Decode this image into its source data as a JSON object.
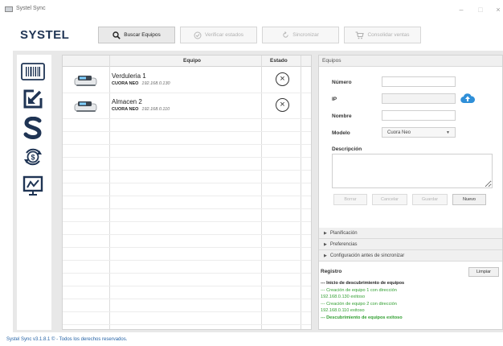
{
  "window": {
    "title": "Systel Sync",
    "controls": {
      "minimize": "–",
      "maximize": "□",
      "close": "×"
    }
  },
  "header": {
    "logo": "SYSTEL",
    "toolbar": [
      {
        "label": "Buscar Equipos",
        "icon": "search-icon",
        "active": true
      },
      {
        "label": "Verificar estados",
        "icon": "check-circle-icon",
        "active": false
      },
      {
        "label": "Sincronizar",
        "icon": "sync-icon",
        "active": false
      },
      {
        "label": "Consolidar ventas",
        "icon": "cart-icon",
        "active": false
      }
    ]
  },
  "sidebar": {
    "items": [
      {
        "name": "barcode-icon"
      },
      {
        "name": "import-arrow-icon"
      },
      {
        "name": "systel-s-icon"
      },
      {
        "name": "money-cycle-icon"
      },
      {
        "name": "chart-board-icon"
      }
    ]
  },
  "device_list": {
    "columns": [
      "Equipo",
      "Estado"
    ],
    "rows": [
      {
        "name": "Verduleria 1",
        "model": "CUORA NEO",
        "ip": "192.168.0.130",
        "status_icon": "error-x-icon"
      },
      {
        "name": "Almacen 2",
        "model": "CUORA NEO",
        "ip": "192.168.0.110",
        "status_icon": "error-x-icon"
      }
    ]
  },
  "equipos_panel": {
    "title": "Equipos",
    "fields": {
      "numero": {
        "label": "Número",
        "value": ""
      },
      "ip": {
        "label": "IP",
        "value": ""
      },
      "nombre": {
        "label": "Nombre",
        "value": ""
      },
      "modelo": {
        "label": "Modelo",
        "value": "Cuora Neo"
      },
      "descripcion": {
        "label": "Descripción",
        "value": ""
      }
    },
    "buttons": {
      "borrar": "Borrar",
      "cancelar": "Cancelar",
      "guardar": "Guardar",
      "nuevo": "Nuevo"
    }
  },
  "sections": [
    "Planificación",
    "Preferencias",
    "Configuración antes de sincronizar"
  ],
  "registro": {
    "title": "Registro",
    "clear_label": "Limpiar",
    "lines": [
      {
        "text": "--- Inicio de descubrimiento de equipos",
        "style": "black-bold"
      },
      {
        "text": "--- Creación de equipo 1 con dirección",
        "style": "green"
      },
      {
        "text": "192.168.0.130 exitoso",
        "style": "green"
      },
      {
        "text": "--- Creación de equipo 2 con dirección",
        "style": "green"
      },
      {
        "text": "192.168.0.110 exitoso",
        "style": "green"
      },
      {
        "text": "--- Descubrimiento de equipos exitoso",
        "style": "green-bold"
      }
    ]
  },
  "footer": {
    "text": "Systel Sync v3.1.8.1 © - Todos los derechos reservados."
  },
  "colors": {
    "brand": "#1f3454",
    "success": "#2f9e2f",
    "link": "#2563a6",
    "cloud": "#2f8fd8"
  }
}
